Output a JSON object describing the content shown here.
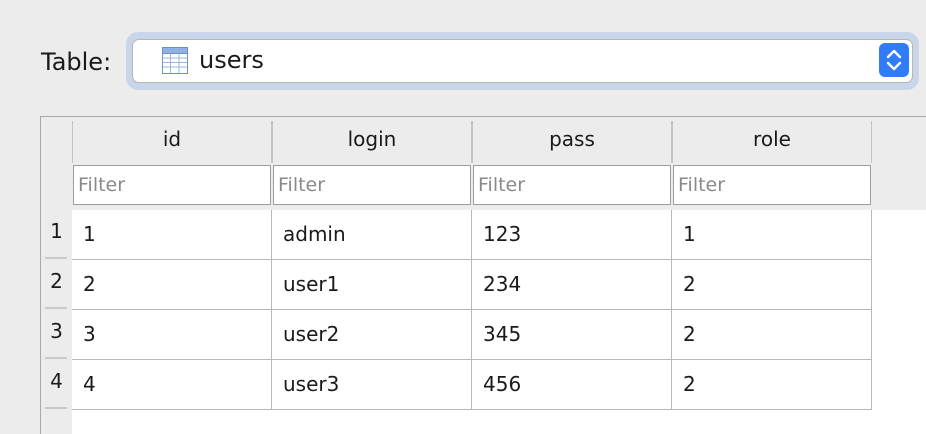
{
  "toolbar": {
    "table_label": "Table:",
    "table_select": {
      "value": "users",
      "icon": "table-grid-icon"
    }
  },
  "grid": {
    "columns": [
      {
        "label": "id",
        "filter_placeholder": "Filter"
      },
      {
        "label": "login",
        "filter_placeholder": "Filter"
      },
      {
        "label": "pass",
        "filter_placeholder": "Filter"
      },
      {
        "label": "role",
        "filter_placeholder": "Filter"
      }
    ],
    "rows": [
      {
        "num": "1",
        "cells": [
          "1",
          "admin",
          "123",
          "1"
        ]
      },
      {
        "num": "2",
        "cells": [
          "2",
          "user1",
          "234",
          "2"
        ]
      },
      {
        "num": "3",
        "cells": [
          "3",
          "user2",
          "345",
          "2"
        ]
      },
      {
        "num": "4",
        "cells": [
          "4",
          "user3",
          "456",
          "2"
        ]
      }
    ]
  },
  "colors": {
    "accent": "#2f7cf6",
    "focus_ring": "#c9d6ea",
    "window_bg": "#ececec"
  }
}
